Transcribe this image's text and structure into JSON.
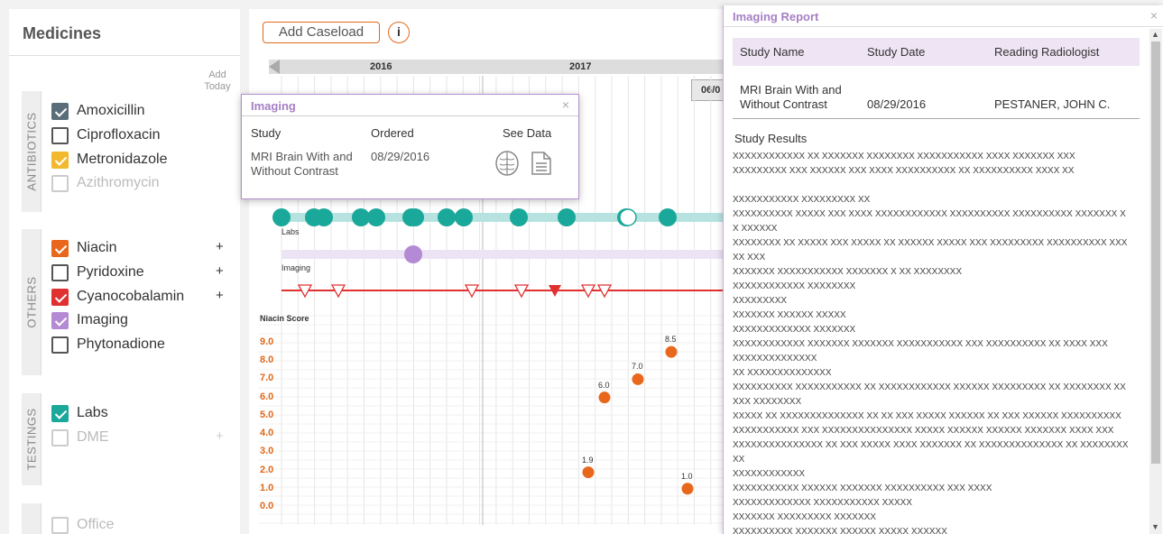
{
  "sidebar": {
    "title": "Medicines",
    "add_today": "Add Today",
    "groups": [
      {
        "label": "ANTIBIOTICS"
      },
      {
        "label": "OTHERS"
      },
      {
        "label": "TESTINGS"
      }
    ],
    "antibiotics": [
      {
        "label": "Amoxicillin",
        "checked": true,
        "color": "#5a6e7a"
      },
      {
        "label": "Ciprofloxacin",
        "checked": false
      },
      {
        "label": "Metronidazole",
        "checked": true,
        "color": "#f3b92e"
      },
      {
        "label": "Azithromycin",
        "checked": false,
        "disabled": true
      }
    ],
    "others": [
      {
        "label": "Niacin",
        "checked": true,
        "color": "#e8671d",
        "plus": "+"
      },
      {
        "label": "Pyridoxine",
        "checked": false,
        "plus": "+"
      },
      {
        "label": "Cyanocobalamin",
        "checked": true,
        "color": "#e03030",
        "plus": "+"
      },
      {
        "label": "Imaging",
        "checked": true,
        "color": "#b58ad4"
      },
      {
        "label": "Phytonadione",
        "checked": false
      }
    ],
    "testings": [
      {
        "label": "Labs",
        "checked": true,
        "color": "#1aa89a"
      },
      {
        "label": "DME",
        "checked": false,
        "disabled": true,
        "plus": "+"
      },
      {
        "label": "Office",
        "checked": false,
        "disabled": true
      }
    ]
  },
  "main": {
    "add_caseload": "Add Caseload",
    "info": "i",
    "years": [
      "2016",
      "2017"
    ],
    "date_tag": "06/0",
    "row_labels": {
      "labs": "Labs",
      "imaging": "Imaging"
    },
    "score_label": "Niacin Score",
    "axis_ticks": [
      "9.0",
      "8.0",
      "7.0",
      "6.0",
      "5.0",
      "4.0",
      "3.0",
      "2.0",
      "1.0",
      "0.0"
    ]
  },
  "chart_data": {
    "type": "scatter",
    "title": "",
    "ylabel": "Niacin Score",
    "ylim": [
      0,
      9
    ],
    "series": [
      {
        "name": "Niacin",
        "color": "#e8671d",
        "values": [
          8.5,
          7.0,
          6.0,
          1.9,
          1.0
        ]
      }
    ],
    "labels": [
      "8.5",
      "7.0",
      "6.0",
      "1.9",
      "1.0"
    ]
  },
  "imaging_popup": {
    "title": "Imaging",
    "close": "×",
    "columns": [
      "Study",
      "Ordered",
      "See Data"
    ],
    "study": "MRI Brain With and Without Contrast",
    "ordered": "08/29/2016",
    "icons": [
      "brain-icon",
      "document-icon"
    ]
  },
  "report": {
    "title": "Imaging Report",
    "close": "×",
    "headers": [
      "Study Name",
      "Study Date",
      "Reading Radiologist"
    ],
    "study_name": "MRI Brain With and Without Contrast",
    "study_date": "08/29/2016",
    "radiologist": "PESTANER, JOHN C.",
    "results_title": "Study Results",
    "results_text": "XXXXXXXXXXXX XX XXXXXXX XXXXXXXX XXXXXXXXXXX XXXX XXXXXXX XXX\nXXXXXXXXX XXX XXXXXX XXX XXXX XXXXXXXXXX XX XXXXXXXXXX XXXX XX\n\nXXXXXXXXXXX XXXXXXXXX XX\nXXXXXXXXXX XXXXX XXX XXXX XXXXXXXXXXXX XXXXXXXXXX XXXXXXXXXX XXXXXXX XX XXXXXX\nXXXXXXXX XX XXXXX XXX XXXXX XX XXXXXX XXXXX XXX XXXXXXXXX XXXXXXXXXX XXXXX XXX\nXXXXXXX XXXXXXXXXXX XXXXXXX X XX XXXXXXXX\nXXXXXXXXXXXX XXXXXXXX\nXXXXXXXXX\nXXXXXXX XXXXXX XXXXX\nXXXXXXXXXXXXX XXXXXXX\nXXXXXXXXXXXX XXXXXXX XXXXXXX XXXXXXXXXXX XXX XXXXXXXXXX XX XXXX XXX\nXXXXXXXXXXXXXX\nXX XXXXXXXXXXXXXX\nXXXXXXXXXX XXXXXXXXXXX XX XXXXXXXXXXXX XXXXXX XXXXXXXXX XX XXXXXXXX XXXXX XXXXXXXX\nXXXXX XX XXXXXXXXXXXXXX XX XX XXX XXXXX XXXXXX XX XXX XXXXXX XXXXXXXXXX\nXXXXXXXXXXX XXX XXXXXXXXXXXXXXX XXXXX XXXXXX XXXXXX XXXXXXX XXXX XXX\nXXXXXXXXXXXXXXX XX XXX XXXXX XXXX XXXXXXX XX XXXXXXXXXXXXXX XX XXXXXXXXXX\nXXXXXXXXXXXX\nXXXXXXXXXXX XXXXXX XXXXXXX XXXXXXXXXX XXX XXXX\nXXXXXXXXXXXXX XXXXXXXXXXX XXXXX\nXXXXXXX XXXXXXXXX XXXXXXX\nXXXXXXXXXX XXXXXXX XXXXXX XXXXX XXXXXX\nXXXXXXXXXXXX XXXXXX XXXXXX XXX XXXXXXXXX XXXX"
  }
}
